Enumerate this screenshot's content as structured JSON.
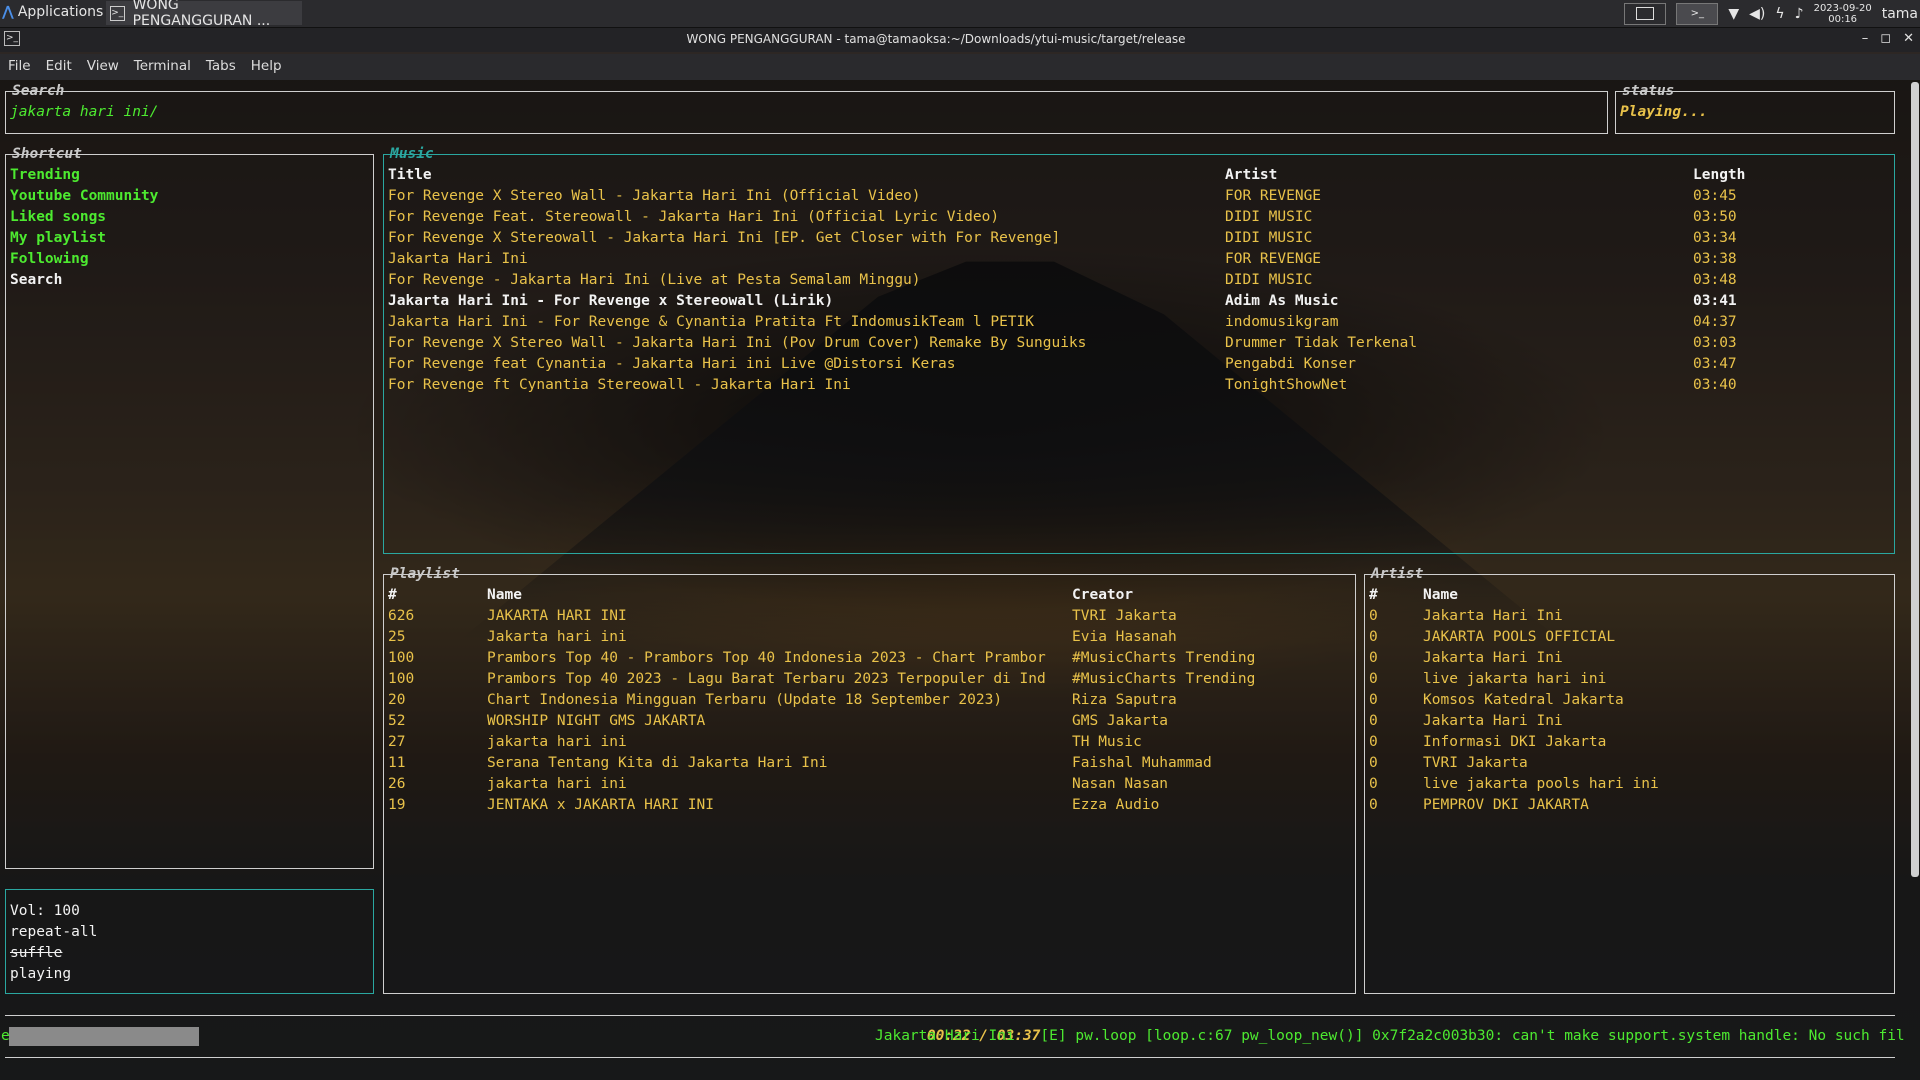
{
  "system_bar": {
    "applications_label": "Applications",
    "task_label": "WONG PENGANGGURAN ...",
    "clock_date": "2023-09-20",
    "clock_time": "00:16",
    "user": "tama"
  },
  "window": {
    "title": "WONG PENGANGGURAN - tama@tamaoksa:~/Downloads/ytui-music/target/release"
  },
  "menu": [
    "File",
    "Edit",
    "View",
    "Terminal",
    "Tabs",
    "Help"
  ],
  "search": {
    "label": "Search",
    "value": "jakarta hari ini/"
  },
  "status": {
    "label": "status",
    "value": "Playing..."
  },
  "shortcut": {
    "label": "Shortcut",
    "items": [
      "Trending",
      "Youtube Community",
      "Liked songs",
      "My playlist",
      "Following",
      "Search"
    ]
  },
  "music": {
    "label": "Music",
    "headers": {
      "title": "Title",
      "artist": "Artist",
      "length": "Length"
    },
    "rows": [
      {
        "title": "For Revenge X Stereo Wall - Jakarta Hari Ini (Official Video)",
        "artist": "FOR REVENGE",
        "length": "03:45"
      },
      {
        "title": "For Revenge Feat. Stereowall - Jakarta Hari Ini (Official Lyric Video)",
        "artist": "DIDI MUSIC",
        "length": "03:50"
      },
      {
        "title": "For Revenge X Stereowall - Jakarta Hari Ini [EP. Get Closer with For Revenge]",
        "artist": "DIDI MUSIC",
        "length": "03:34"
      },
      {
        "title": "Jakarta Hari Ini",
        "artist": "FOR REVENGE",
        "length": "03:38"
      },
      {
        "title": "For Revenge - Jakarta Hari Ini (Live at Pesta Semalam Minggu)",
        "artist": "DIDI MUSIC",
        "length": "03:48"
      },
      {
        "title": "Jakarta Hari Ini - For Revenge x Stereowall (Lirik)",
        "artist": "Adim As Music",
        "length": "03:41"
      },
      {
        "title": "Jakarta Hari Ini - For Revenge & Cynantia Pratita Ft IndomusikTeam l PETIK",
        "artist": "indomusikgram",
        "length": "04:37"
      },
      {
        "title": "For Revenge X Stereo Wall - Jakarta Hari Ini (Pov Drum Cover) Remake By Sunguiks",
        "artist": "Drummer Tidak Terkenal",
        "length": "03:03"
      },
      {
        "title": "For Revenge feat Cynantia - Jakarta Hari ini Live @Distorsi Keras",
        "artist": "Pengabdi Konser",
        "length": "03:47"
      },
      {
        "title": "For Revenge ft Cynantia Stereowall - Jakarta Hari Ini",
        "artist": "TonightShowNet",
        "length": "03:40"
      }
    ]
  },
  "playlist": {
    "label": "Playlist",
    "headers": {
      "num": "#",
      "name": "Name",
      "creator": "Creator"
    },
    "rows": [
      {
        "num": "626",
        "name": "JAKARTA HARI INI",
        "creator": "TVRI Jakarta"
      },
      {
        "num": "25",
        "name": "Jakarta hari ini",
        "creator": "Evia Hasanah"
      },
      {
        "num": "100",
        "name": "Prambors Top 40 - Prambors Top 40 Indonesia 2023 - Chart Prambor",
        "creator": "#MusicCharts Trending"
      },
      {
        "num": "100",
        "name": "Prambors Top 40 2023 - Lagu Barat Terbaru 2023 Terpopuler di Ind",
        "creator": "#MusicCharts Trending"
      },
      {
        "num": "20",
        "name": "Chart Indonesia Mingguan Terbaru (Update 18 September 2023)",
        "creator": "Riza Saputra"
      },
      {
        "num": "52",
        "name": "WORSHIP NIGHT GMS JAKARTA",
        "creator": "GMS Jakarta"
      },
      {
        "num": "27",
        "name": "jakarta hari ini",
        "creator": "TH Music"
      },
      {
        "num": "11",
        "name": "Serana Tentang Kita di Jakarta Hari Ini",
        "creator": "Faishal Muhammad"
      },
      {
        "num": "26",
        "name": "jakarta hari ini",
        "creator": "Nasan Nasan"
      },
      {
        "num": "19",
        "name": "JENTAKA x JAKARTA HARI INI",
        "creator": "Ezza Audio"
      }
    ]
  },
  "artist": {
    "label": "Artist",
    "headers": {
      "num": "#",
      "name": "Name"
    },
    "rows": [
      {
        "num": "0",
        "name": "Jakarta Hari Ini"
      },
      {
        "num": "0",
        "name": "JAKARTA POOLS OFFICIAL"
      },
      {
        "num": "0",
        "name": "Jakarta Hari Ini"
      },
      {
        "num": "0",
        "name": "live jakarta hari ini"
      },
      {
        "num": "0",
        "name": "Komsos Katedral Jakarta"
      },
      {
        "num": "0",
        "name": "Jakarta Hari Ini"
      },
      {
        "num": "0",
        "name": "Informasi DKI Jakarta"
      },
      {
        "num": "0",
        "name": "TVRI Jakarta"
      },
      {
        "num": "0",
        "name": "live jakarta pools hari ini"
      },
      {
        "num": "0",
        "name": "PEMPROV DKI JAKARTA"
      }
    ]
  },
  "player_state": {
    "volume": "Vol: 100",
    "repeat": "repeat-all",
    "shuffle": "suffle",
    "state": "playing"
  },
  "bottom": {
    "time": "00:22 / 03:37",
    "error": "[E] pw.loop [loop.c:67 pw_loop_new()] 0x7f2a2c003b30: can't make support.system handle: No such fil",
    "prefix": "e",
    "now_playing": "Jakarta Hari Ini",
    "progress": 0.101
  },
  "colors": {
    "accent": "#2aa7a0",
    "yellow": "#e9c24a",
    "green": "#4dea30"
  }
}
